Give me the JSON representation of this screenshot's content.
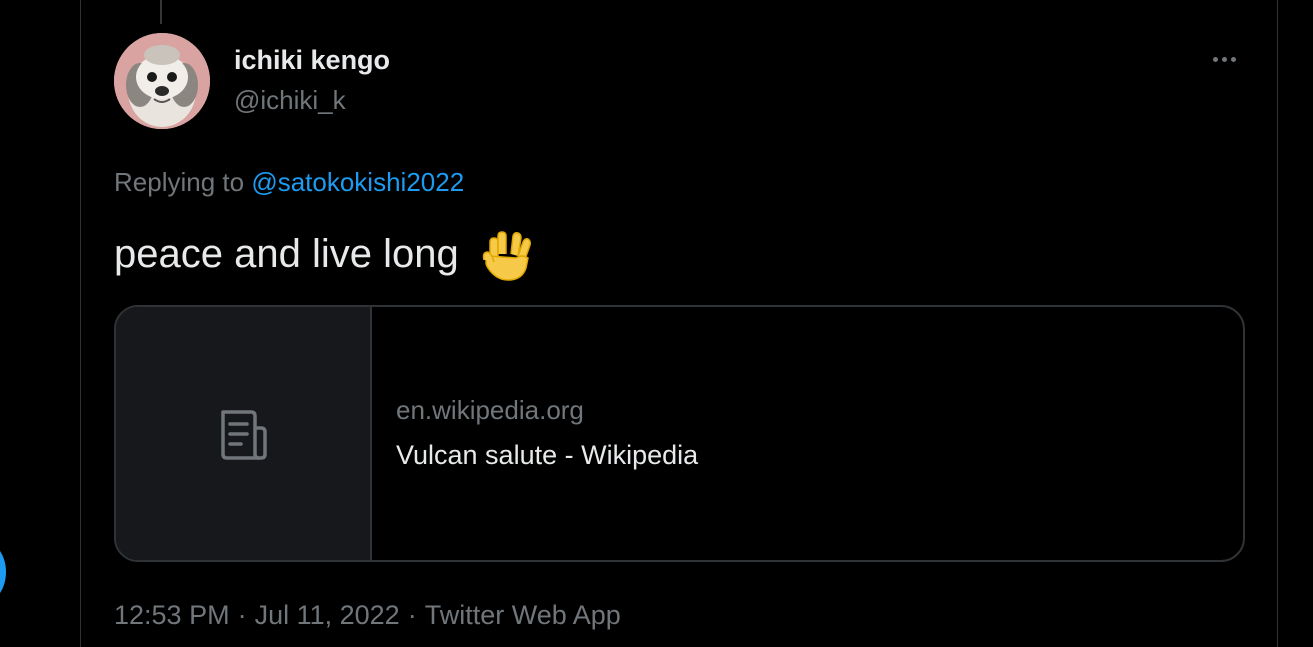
{
  "tweet": {
    "author_name": "ichiki kengo",
    "author_handle": "@ichiki_k",
    "replying_prefix": "Replying to",
    "replying_to": "@satokokishi2022",
    "text": "peace and live long",
    "emoji": "vulcan-salute-emoji"
  },
  "card": {
    "domain": "en.wikipedia.org",
    "title": "Vulcan salute - Wikipedia",
    "thumb_icon": "document-icon"
  },
  "meta": {
    "time": "12:53 PM",
    "separator": "·",
    "date": "Jul 11, 2022",
    "source": "Twitter Web App"
  },
  "colors": {
    "background": "#000000",
    "accent": "#1d9bf0",
    "secondary_text": "#71767b",
    "primary_text": "#e7e9ea",
    "border": "#2f3336"
  }
}
